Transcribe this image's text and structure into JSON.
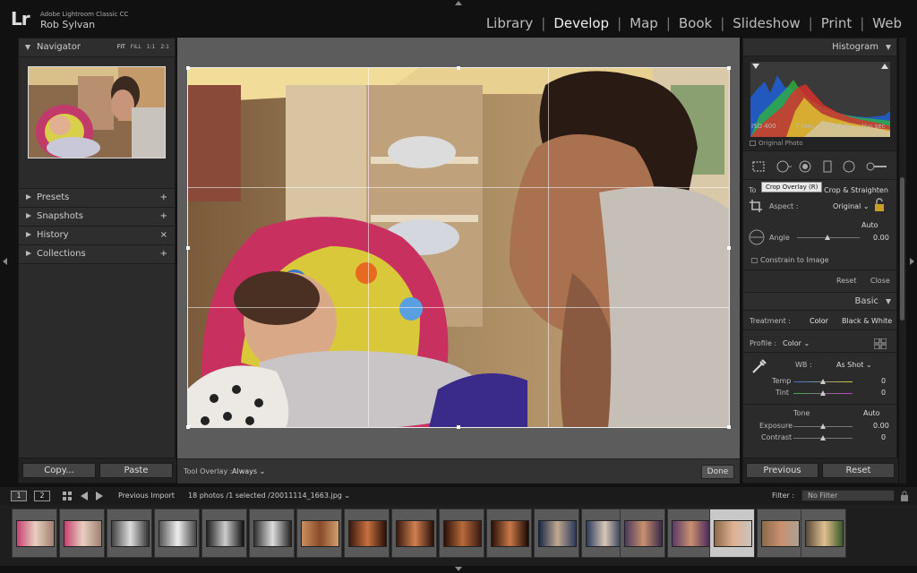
{
  "app": {
    "logo": "Lr",
    "title": "Adobe Lightroom Classic CC",
    "user": "Rob Sylvan"
  },
  "modules": [
    {
      "label": "Library",
      "active": false
    },
    {
      "label": "Develop",
      "active": true
    },
    {
      "label": "Map",
      "active": false
    },
    {
      "label": "Book",
      "active": false
    },
    {
      "label": "Slideshow",
      "active": false
    },
    {
      "label": "Print",
      "active": false
    },
    {
      "label": "Web",
      "active": false
    }
  ],
  "left_panel": {
    "navigator": {
      "label": "Navigator",
      "zoom_options": [
        "FIT",
        "FILL",
        "1:1",
        "2:1"
      ]
    },
    "sections": [
      {
        "label": "Presets",
        "action": "+"
      },
      {
        "label": "Snapshots",
        "action": "+"
      },
      {
        "label": "History",
        "action": "×"
      },
      {
        "label": "Collections",
        "action": "+"
      }
    ],
    "copy_label": "Copy...",
    "paste_label": "Paste"
  },
  "toolbar": {
    "tool_overlay_label": "Tool Overlay :",
    "tool_overlay_value": "Always",
    "done_label": "Done"
  },
  "right_panel": {
    "histogram": {
      "label": "Histogram",
      "iso": "ISO 400",
      "focal": "7 mm",
      "aperture": "ƒ / 2.9",
      "shutter": "¹⁄₁₈₀ sec",
      "original_photo": "Original Photo"
    },
    "tooltip": "Crop Overlay (R)",
    "crop": {
      "tools_label": "To",
      "title": "Crop & Straighten",
      "aspect_label": "Aspect :",
      "aspect_value": "Original",
      "auto_label": "Auto",
      "angle_label": "Angle",
      "angle_value": "0.00",
      "constrain_label": "Constrain to Image",
      "reset_label": "Reset",
      "close_label": "Close"
    },
    "basic": {
      "label": "Basic",
      "treatment_label": "Treatment :",
      "treatment_color": "Color",
      "treatment_bw": "Black & White",
      "profile_label": "Profile :",
      "profile_value": "Color",
      "wb_label": "WB :",
      "wb_value": "As Shot",
      "temp_label": "Temp",
      "temp_value": "0",
      "tint_label": "Tint",
      "tint_value": "0",
      "tone_label": "Tone",
      "tone_auto": "Auto",
      "exposure_label": "Exposure",
      "exposure_value": "0.00",
      "contrast_label": "Contrast",
      "contrast_value": "0"
    },
    "previous_label": "Previous",
    "reset_label": "Reset"
  },
  "filmstrip_bar": {
    "screen1": "1",
    "screen2": "2",
    "source": "Previous Import",
    "count": "18 photos /1 selected /",
    "filename": "20011114_1663.jpg",
    "filter_label": "Filter :",
    "filter_value": "No Filter"
  },
  "filmstrip": {
    "total": 18,
    "selected_index": 15
  }
}
